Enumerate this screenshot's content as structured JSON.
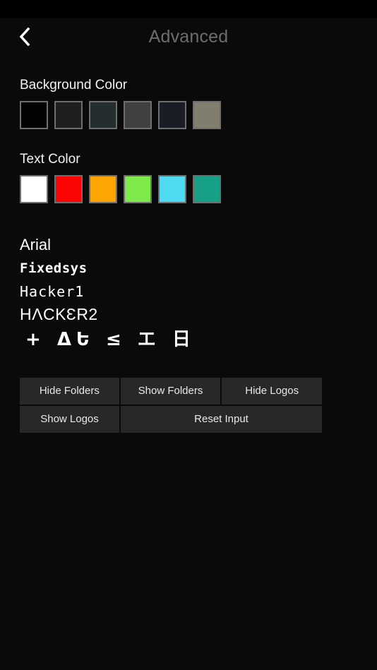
{
  "status_bar": {},
  "app_bar": {
    "back_icon": "chevron-left-icon",
    "title": "Advanced",
    "title_color": "#6d6d6d"
  },
  "sections": {
    "background_color": {
      "label": "Background Color",
      "swatches": [
        {
          "name": "bg-swatch-black",
          "color": "#020202"
        },
        {
          "name": "bg-swatch-dark",
          "color": "#1f1f1f"
        },
        {
          "name": "bg-swatch-slate",
          "color": "#242e30"
        },
        {
          "name": "bg-swatch-gray",
          "color": "#413f3f"
        },
        {
          "name": "bg-swatch-navy",
          "color": "#1a1d26"
        },
        {
          "name": "bg-swatch-khaki",
          "color": "#817e6e"
        }
      ]
    },
    "text_color": {
      "label": "Text Color",
      "swatches": [
        {
          "name": "text-swatch-white",
          "color": "#ffffff"
        },
        {
          "name": "text-swatch-red",
          "color": "#fc0404"
        },
        {
          "name": "text-swatch-orange",
          "color": "#fca503"
        },
        {
          "name": "text-swatch-green",
          "color": "#7ee94a"
        },
        {
          "name": "text-swatch-cyan",
          "color": "#4fdcf2"
        },
        {
          "name": "text-swatch-teal",
          "color": "#16a085"
        }
      ]
    }
  },
  "fonts": [
    {
      "name": "font-option-arial",
      "label": "Arial"
    },
    {
      "name": "font-option-fixedsys",
      "label": "Fixedsys"
    },
    {
      "name": "font-option-hacker1",
      "label": "Hacker1"
    },
    {
      "name": "font-option-hacker2",
      "label": "HΛCKƐR2"
    },
    {
      "name": "font-option-symbols",
      "label": "+ ΔԵ ≤ エ 日"
    }
  ],
  "buttons": {
    "row1": [
      {
        "name": "hide-folders-button",
        "label": "Hide Folders"
      },
      {
        "name": "show-folders-button",
        "label": "Show Folders"
      },
      {
        "name": "hide-logos-button",
        "label": "Hide Logos"
      }
    ],
    "row2": [
      {
        "name": "show-logos-button",
        "label": "Show Logos"
      },
      {
        "name": "reset-input-button",
        "label": "Reset Input"
      }
    ]
  }
}
